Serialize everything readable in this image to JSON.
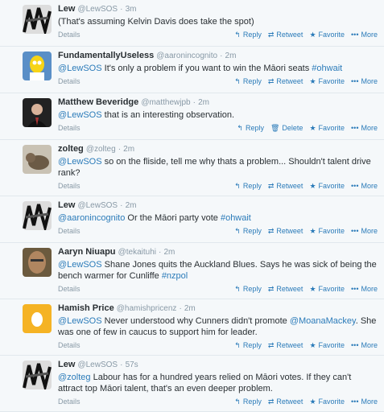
{
  "tweets": [
    {
      "fullname": "Lew",
      "handle": "@LewSOS",
      "time": "3m",
      "parts": [
        {
          "t": "(That's assuming Kelvin Davis does take the spot)",
          "link": false
        }
      ],
      "details": "Details",
      "actions": [
        "Reply",
        "Retweet",
        "Favorite",
        "More"
      ],
      "avatar": "bw"
    },
    {
      "fullname": "FundamentallyUseless",
      "handle": "@aaronincognito",
      "time": "2m",
      "parts": [
        {
          "t": "@LewSOS",
          "link": true
        },
        {
          "t": " It's only a problem if you want to win the Māori seats ",
          "link": false
        },
        {
          "t": "#ohwait",
          "link": true
        }
      ],
      "details": "Details",
      "actions": [
        "Reply",
        "Retweet",
        "Favorite",
        "More"
      ],
      "avatar": "simpson"
    },
    {
      "fullname": "Matthew Beveridge",
      "handle": "@matthewjpb",
      "time": "2m",
      "parts": [
        {
          "t": "@LewSOS",
          "link": true
        },
        {
          "t": " that is an interesting observation.",
          "link": false
        }
      ],
      "details": "Details",
      "actions": [
        "Reply",
        "Delete",
        "Favorite",
        "More"
      ],
      "avatar": "man"
    },
    {
      "fullname": "zolteg",
      "handle": "@zolteg",
      "time": "2m",
      "parts": [
        {
          "t": "@LewSOS",
          "link": true
        },
        {
          "t": " so on the fliside, tell me why thats a problem... Shouldn't talent drive rank?",
          "link": false
        }
      ],
      "details": "Details",
      "actions": [
        "Reply",
        "Retweet",
        "Favorite",
        "More"
      ],
      "avatar": "animal"
    },
    {
      "fullname": "Lew",
      "handle": "@LewSOS",
      "time": "2m",
      "parts": [
        {
          "t": "@aaronincognito",
          "link": true
        },
        {
          "t": " Or the Māori party vote ",
          "link": false
        },
        {
          "t": "#ohwait",
          "link": true
        }
      ],
      "details": "Details",
      "actions": [
        "Reply",
        "Retweet",
        "Favorite",
        "More"
      ],
      "avatar": "bw"
    },
    {
      "fullname": "Aaryn Niuapu",
      "handle": "@tekaituhi",
      "time": "2m",
      "parts": [
        {
          "t": "@LewSOS",
          "link": true
        },
        {
          "t": " Shane Jones quits the Auckland Blues. Says he was sick of being the bench warmer for Cunliffe ",
          "link": false
        },
        {
          "t": "#nzpol",
          "link": true
        }
      ],
      "details": "Details",
      "actions": [
        "Reply",
        "Retweet",
        "Favorite",
        "More"
      ],
      "avatar": "face"
    },
    {
      "fullname": "Hamish Price",
      "handle": "@hamishpricenz",
      "time": "2m",
      "parts": [
        {
          "t": "@LewSOS",
          "link": true
        },
        {
          "t": " Never understood why Cunners didn't promote ",
          "link": false
        },
        {
          "t": "@MoanaMackey",
          "link": true
        },
        {
          "t": ". She was one of few in caucus to support him for leader.",
          "link": false
        }
      ],
      "details": "Details",
      "actions": [
        "Reply",
        "Retweet",
        "Favorite",
        "More"
      ],
      "avatar": "egg"
    },
    {
      "fullname": "Lew",
      "handle": "@LewSOS",
      "time": "57s",
      "parts": [
        {
          "t": "@zolteg",
          "link": true
        },
        {
          "t": " Labour has for a hundred years relied on Māori votes. If they can't attract top Māori talent, that's an even deeper problem.",
          "link": false
        }
      ],
      "details": "Details",
      "actions": [
        "Reply",
        "Retweet",
        "Favorite",
        "More"
      ],
      "avatar": "bw"
    }
  ],
  "colors": {
    "link": "#2b7bb9",
    "meta": "#8899a6",
    "text": "#292f33",
    "divider": "#e1e8ed",
    "egg_bg": "#f5b324"
  }
}
